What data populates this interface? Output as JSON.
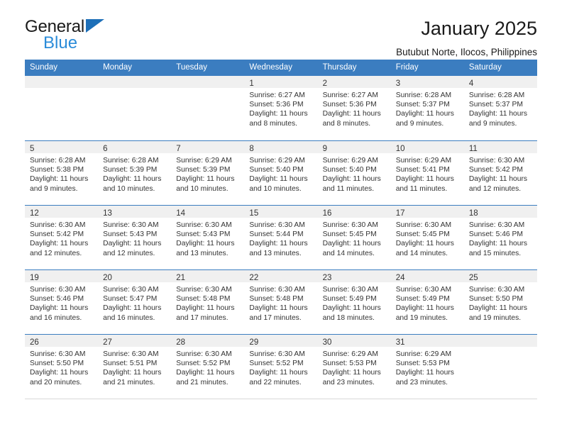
{
  "brand": {
    "line1": "General",
    "line2": "Blue",
    "accent_color": "#2b8cd9",
    "triangle_color": "#1d6fb8"
  },
  "header": {
    "title": "January 2025",
    "subtitle": "Butubut Norte, Ilocos, Philippines"
  },
  "theme": {
    "header_bg": "#3b7dc0",
    "day_band_bg": "#f0f0f0",
    "text_color": "#333333"
  },
  "weekdays": [
    "Sunday",
    "Monday",
    "Tuesday",
    "Wednesday",
    "Thursday",
    "Friday",
    "Saturday"
  ],
  "labels": {
    "sunrise": "Sunrise:",
    "sunset": "Sunset:",
    "daylight": "Daylight:"
  },
  "weeks": [
    [
      {
        "day": ""
      },
      {
        "day": ""
      },
      {
        "day": ""
      },
      {
        "day": "1",
        "sunrise": "Sunrise: 6:27 AM",
        "sunset": "Sunset: 5:36 PM",
        "daylight": "Daylight: 11 hours and 8 minutes."
      },
      {
        "day": "2",
        "sunrise": "Sunrise: 6:27 AM",
        "sunset": "Sunset: 5:36 PM",
        "daylight": "Daylight: 11 hours and 8 minutes."
      },
      {
        "day": "3",
        "sunrise": "Sunrise: 6:28 AM",
        "sunset": "Sunset: 5:37 PM",
        "daylight": "Daylight: 11 hours and 9 minutes."
      },
      {
        "day": "4",
        "sunrise": "Sunrise: 6:28 AM",
        "sunset": "Sunset: 5:37 PM",
        "daylight": "Daylight: 11 hours and 9 minutes."
      }
    ],
    [
      {
        "day": "5",
        "sunrise": "Sunrise: 6:28 AM",
        "sunset": "Sunset: 5:38 PM",
        "daylight": "Daylight: 11 hours and 9 minutes."
      },
      {
        "day": "6",
        "sunrise": "Sunrise: 6:28 AM",
        "sunset": "Sunset: 5:39 PM",
        "daylight": "Daylight: 11 hours and 10 minutes."
      },
      {
        "day": "7",
        "sunrise": "Sunrise: 6:29 AM",
        "sunset": "Sunset: 5:39 PM",
        "daylight": "Daylight: 11 hours and 10 minutes."
      },
      {
        "day": "8",
        "sunrise": "Sunrise: 6:29 AM",
        "sunset": "Sunset: 5:40 PM",
        "daylight": "Daylight: 11 hours and 10 minutes."
      },
      {
        "day": "9",
        "sunrise": "Sunrise: 6:29 AM",
        "sunset": "Sunset: 5:40 PM",
        "daylight": "Daylight: 11 hours and 11 minutes."
      },
      {
        "day": "10",
        "sunrise": "Sunrise: 6:29 AM",
        "sunset": "Sunset: 5:41 PM",
        "daylight": "Daylight: 11 hours and 11 minutes."
      },
      {
        "day": "11",
        "sunrise": "Sunrise: 6:30 AM",
        "sunset": "Sunset: 5:42 PM",
        "daylight": "Daylight: 11 hours and 12 minutes."
      }
    ],
    [
      {
        "day": "12",
        "sunrise": "Sunrise: 6:30 AM",
        "sunset": "Sunset: 5:42 PM",
        "daylight": "Daylight: 11 hours and 12 minutes."
      },
      {
        "day": "13",
        "sunrise": "Sunrise: 6:30 AM",
        "sunset": "Sunset: 5:43 PM",
        "daylight": "Daylight: 11 hours and 12 minutes."
      },
      {
        "day": "14",
        "sunrise": "Sunrise: 6:30 AM",
        "sunset": "Sunset: 5:43 PM",
        "daylight": "Daylight: 11 hours and 13 minutes."
      },
      {
        "day": "15",
        "sunrise": "Sunrise: 6:30 AM",
        "sunset": "Sunset: 5:44 PM",
        "daylight": "Daylight: 11 hours and 13 minutes."
      },
      {
        "day": "16",
        "sunrise": "Sunrise: 6:30 AM",
        "sunset": "Sunset: 5:45 PM",
        "daylight": "Daylight: 11 hours and 14 minutes."
      },
      {
        "day": "17",
        "sunrise": "Sunrise: 6:30 AM",
        "sunset": "Sunset: 5:45 PM",
        "daylight": "Daylight: 11 hours and 14 minutes."
      },
      {
        "day": "18",
        "sunrise": "Sunrise: 6:30 AM",
        "sunset": "Sunset: 5:46 PM",
        "daylight": "Daylight: 11 hours and 15 minutes."
      }
    ],
    [
      {
        "day": "19",
        "sunrise": "Sunrise: 6:30 AM",
        "sunset": "Sunset: 5:46 PM",
        "daylight": "Daylight: 11 hours and 16 minutes."
      },
      {
        "day": "20",
        "sunrise": "Sunrise: 6:30 AM",
        "sunset": "Sunset: 5:47 PM",
        "daylight": "Daylight: 11 hours and 16 minutes."
      },
      {
        "day": "21",
        "sunrise": "Sunrise: 6:30 AM",
        "sunset": "Sunset: 5:48 PM",
        "daylight": "Daylight: 11 hours and 17 minutes."
      },
      {
        "day": "22",
        "sunrise": "Sunrise: 6:30 AM",
        "sunset": "Sunset: 5:48 PM",
        "daylight": "Daylight: 11 hours and 17 minutes."
      },
      {
        "day": "23",
        "sunrise": "Sunrise: 6:30 AM",
        "sunset": "Sunset: 5:49 PM",
        "daylight": "Daylight: 11 hours and 18 minutes."
      },
      {
        "day": "24",
        "sunrise": "Sunrise: 6:30 AM",
        "sunset": "Sunset: 5:49 PM",
        "daylight": "Daylight: 11 hours and 19 minutes."
      },
      {
        "day": "25",
        "sunrise": "Sunrise: 6:30 AM",
        "sunset": "Sunset: 5:50 PM",
        "daylight": "Daylight: 11 hours and 19 minutes."
      }
    ],
    [
      {
        "day": "26",
        "sunrise": "Sunrise: 6:30 AM",
        "sunset": "Sunset: 5:50 PM",
        "daylight": "Daylight: 11 hours and 20 minutes."
      },
      {
        "day": "27",
        "sunrise": "Sunrise: 6:30 AM",
        "sunset": "Sunset: 5:51 PM",
        "daylight": "Daylight: 11 hours and 21 minutes."
      },
      {
        "day": "28",
        "sunrise": "Sunrise: 6:30 AM",
        "sunset": "Sunset: 5:52 PM",
        "daylight": "Daylight: 11 hours and 21 minutes."
      },
      {
        "day": "29",
        "sunrise": "Sunrise: 6:30 AM",
        "sunset": "Sunset: 5:52 PM",
        "daylight": "Daylight: 11 hours and 22 minutes."
      },
      {
        "day": "30",
        "sunrise": "Sunrise: 6:29 AM",
        "sunset": "Sunset: 5:53 PM",
        "daylight": "Daylight: 11 hours and 23 minutes."
      },
      {
        "day": "31",
        "sunrise": "Sunrise: 6:29 AM",
        "sunset": "Sunset: 5:53 PM",
        "daylight": "Daylight: 11 hours and 23 minutes."
      },
      {
        "day": ""
      }
    ]
  ]
}
